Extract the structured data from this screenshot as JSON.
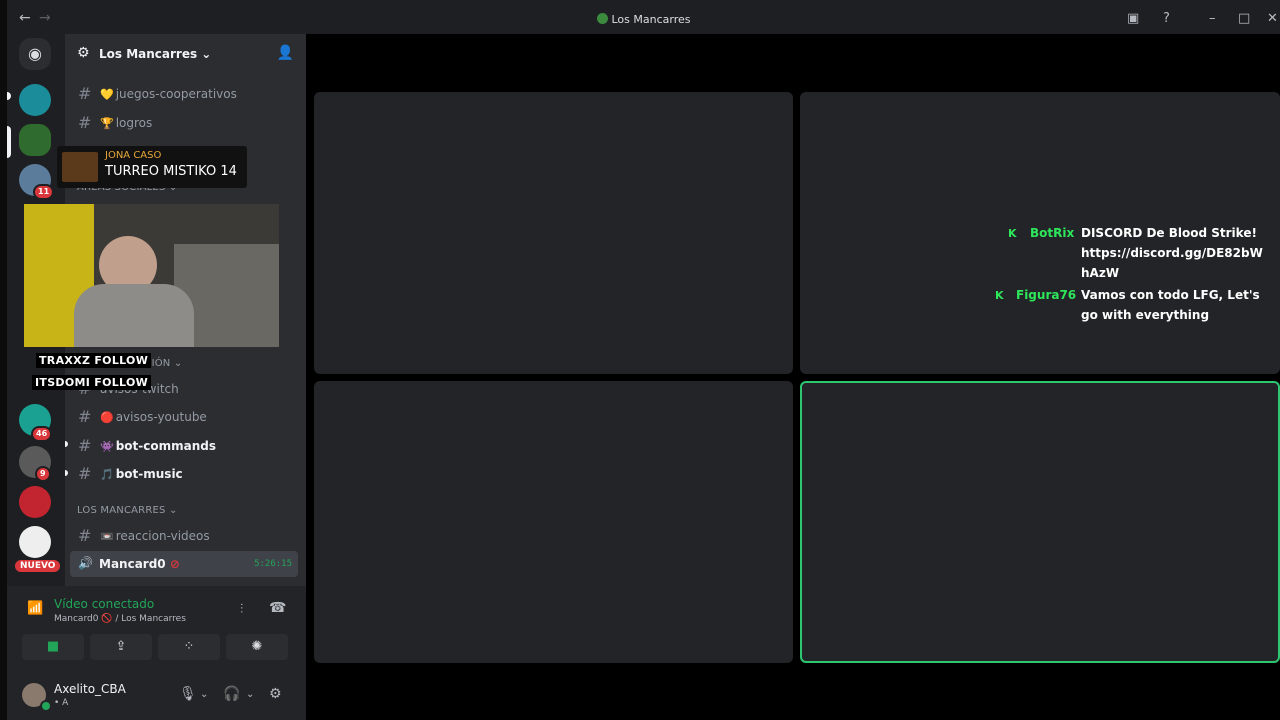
{
  "window": {
    "title": "Los Mancarres"
  },
  "guilds": {
    "badges": [
      "11",
      "46",
      "9"
    ],
    "new_label": "NUEVO"
  },
  "server": {
    "name": "Los Mancarres"
  },
  "channels": {
    "top": [
      {
        "emoji": "💛",
        "name": "juegos-cooperativos"
      },
      {
        "emoji": "🏆",
        "name": "logros"
      }
    ],
    "cat_social": "ÁREAS SOCIALES",
    "cat_auto": "AUTOMATIZACIÓN",
    "auto": [
      {
        "emoji": "",
        "name": "avisos-twitch"
      },
      {
        "emoji": "🔴",
        "name": "avisos-youtube"
      },
      {
        "emoji": "👾",
        "name": "bot-commands"
      },
      {
        "emoji": "🎵",
        "name": "bot-music"
      }
    ],
    "cat_main": "LOS MANCARRES",
    "main": [
      {
        "emoji": "📼",
        "name": "reaccion-videos"
      }
    ],
    "voice": {
      "name": "Mancard0",
      "timer": "5:26:15"
    }
  },
  "voice_panel": {
    "status": "Vídeo conectado",
    "sub": "Mancard0 🚫 / Los Mancarres"
  },
  "user": {
    "name": "Axelito_CBA",
    "status": "• A"
  },
  "overlay": {
    "artist": "JONA CASO",
    "song": "TURREO MISTIKO 14",
    "follows": [
      "TRAXXZ FOLLOW",
      "ITSDOMI FOLLOW"
    ]
  },
  "chat": [
    {
      "user": "BotRix",
      "lines": [
        "DISCORD De Blood Strike!",
        "https://discord.gg/DE82bW",
        "hAzW"
      ]
    },
    {
      "user": "Figura76",
      "lines": [
        "Vamos con todo LFG, Let's",
        "go with everything"
      ]
    }
  ],
  "colors": {
    "accent": "#23a559",
    "active_border": "#2dc770",
    "badge": "#da373c"
  }
}
